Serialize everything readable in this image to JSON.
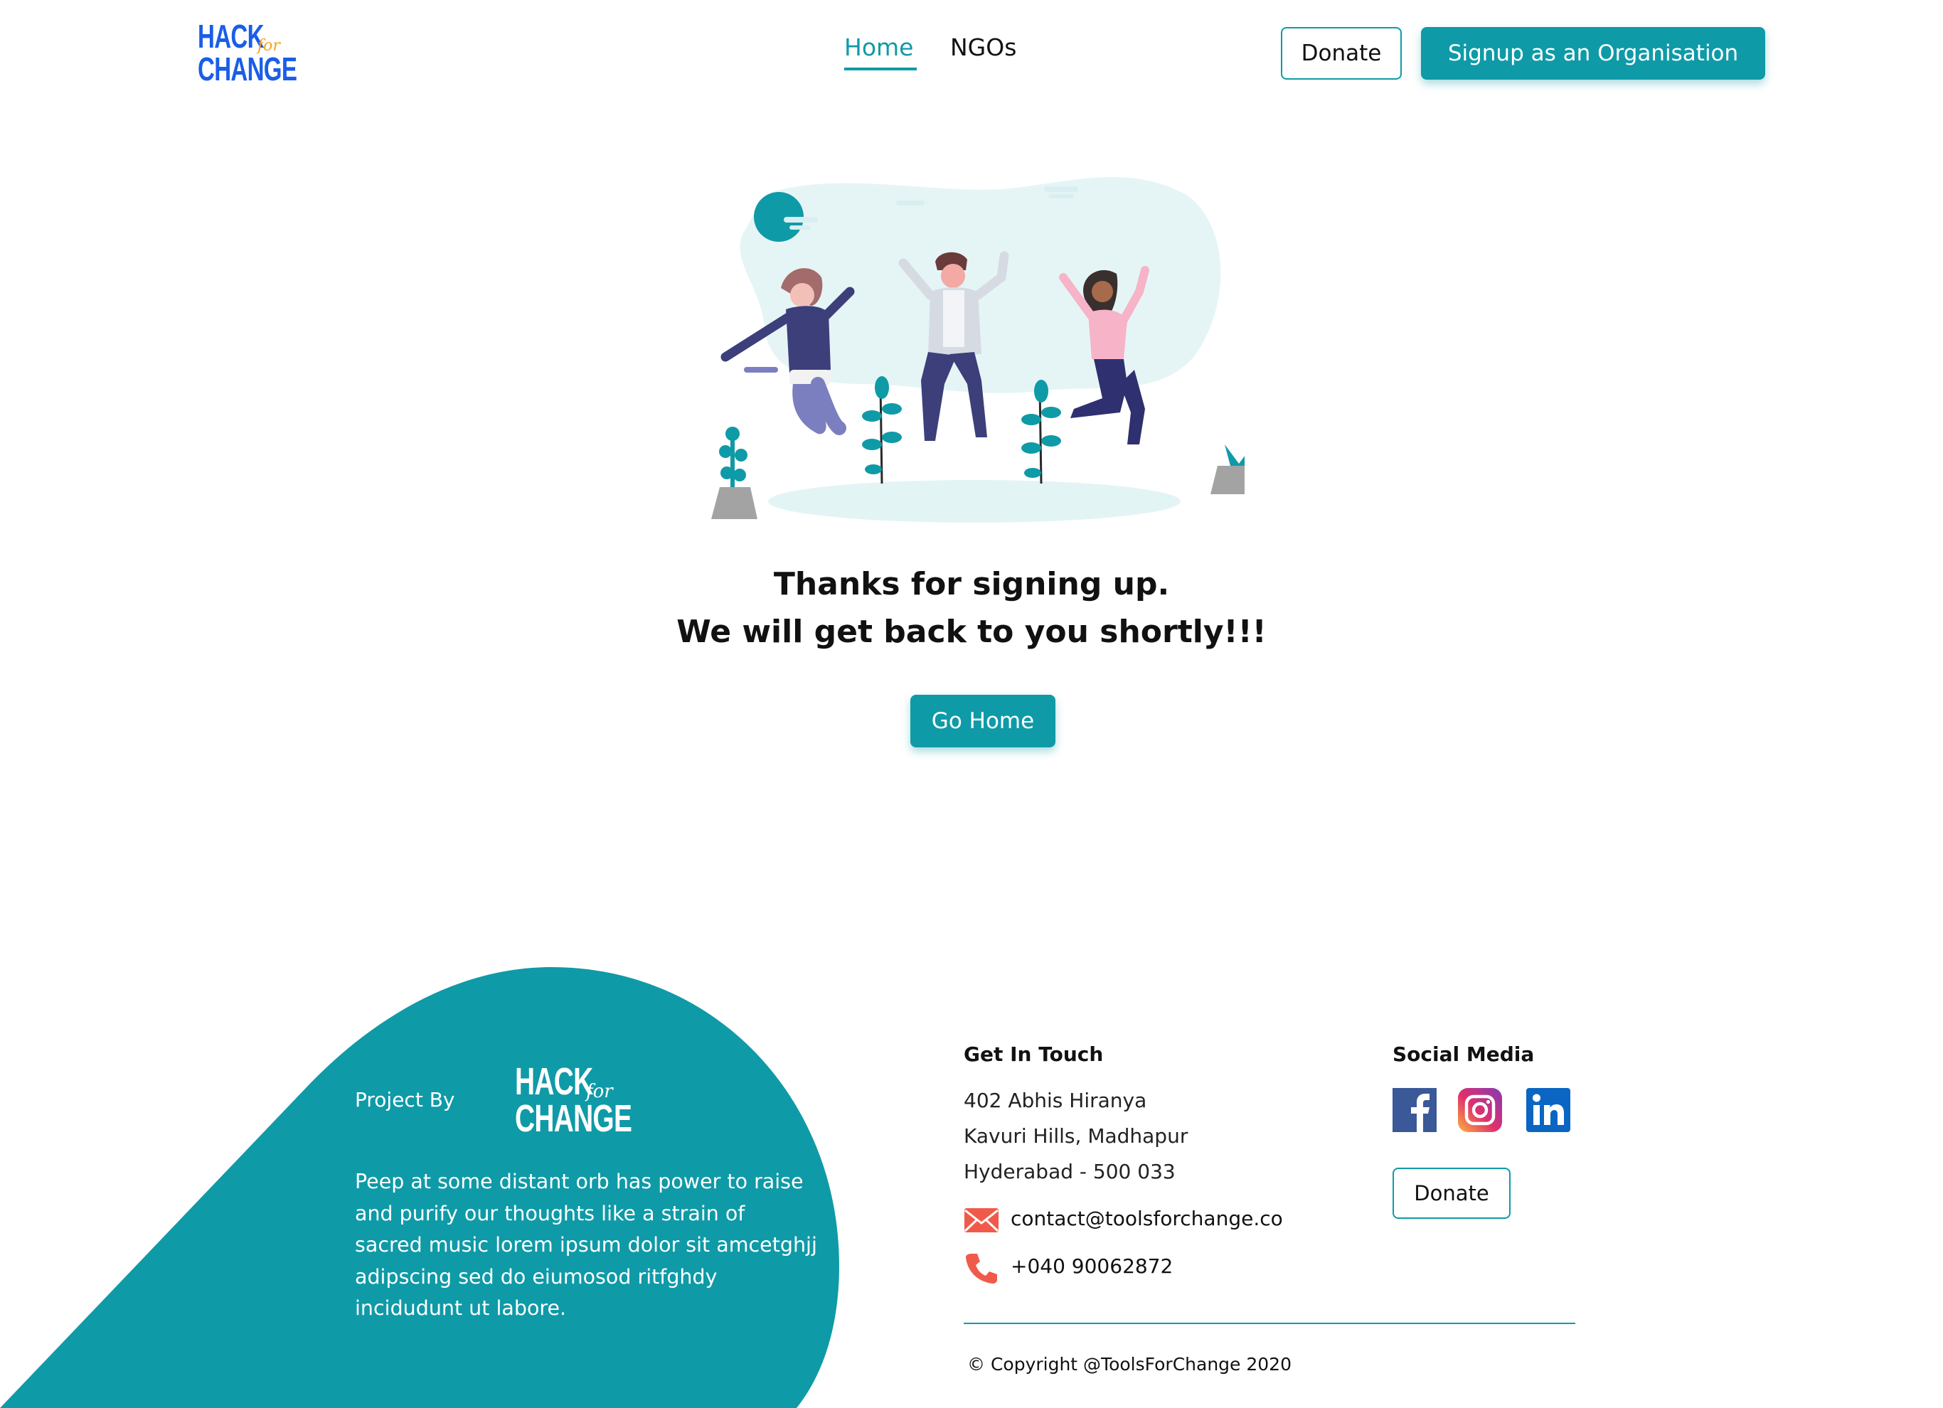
{
  "colors": {
    "accent": "#0f9aa7",
    "logo_blue": "#1a5ee8",
    "logo_orange": "#f3a21f"
  },
  "header": {
    "logo": {
      "line1": "HACK",
      "for": "for",
      "line2": "CHANGE"
    },
    "nav": {
      "home": "Home",
      "ngos": "NGOs"
    },
    "donate_label": "Donate",
    "signup_label": "Signup as an Organisation"
  },
  "main": {
    "illustration_icon": "people-jumping-celebration-illustration",
    "line1": "Thanks for signing up.",
    "line2": "We will get back to you shortly!!!",
    "go_home_label": "Go Home"
  },
  "footer": {
    "project_by": "Project By",
    "logo": {
      "line1": "HACK",
      "for": "for",
      "line2": "CHANGE"
    },
    "description": "Peep at some distant orb has power to raise and purify our thoughts like a strain of sacred music lorem ipsum dolor sit amcetghjj adipscing sed do eiumosod ritfghdy incidudunt ut labore.",
    "get_in_touch": {
      "heading": "Get In Touch",
      "address": [
        "402 Abhis Hiranya",
        "Kavuri Hills, Madhapur",
        "Hyderabad - 500 033"
      ],
      "email": "contact@toolsforchange.co",
      "phone": "+040  90062872"
    },
    "social": {
      "heading": "Social Media",
      "icons": [
        "facebook-icon",
        "instagram-icon",
        "linkedin-icon"
      ],
      "donate_label": "Donate"
    },
    "copyright": "© Copyright @ToolsForChange 2020"
  }
}
